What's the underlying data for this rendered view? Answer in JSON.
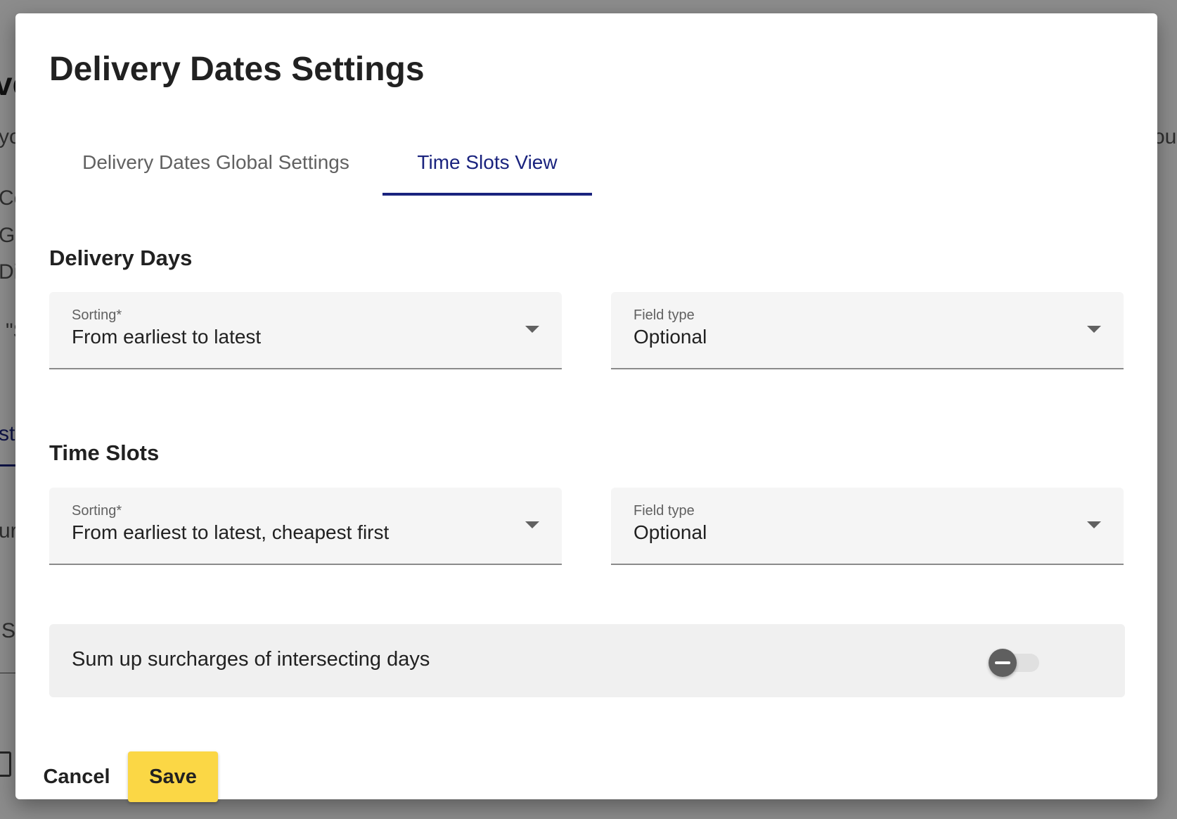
{
  "background": {
    "title_fragment": "ve",
    "text_fragments": [
      "yo",
      "Co",
      "Ge",
      "Dis",
      "\"S",
      "sto",
      "ure",
      "Se",
      "ou"
    ]
  },
  "dialog": {
    "title": "Delivery Dates Settings",
    "tabs": [
      {
        "label": "Delivery Dates Global Settings",
        "active": false
      },
      {
        "label": "Time Slots View",
        "active": true
      }
    ],
    "delivery_days": {
      "title": "Delivery Days",
      "sorting": {
        "label": "Sorting*",
        "value": "From earliest to latest"
      },
      "field_type": {
        "label": "Field type",
        "value": "Optional"
      }
    },
    "time_slots": {
      "title": "Time Slots",
      "sorting": {
        "label": "Sorting*",
        "value": "From earliest to latest, cheapest first"
      },
      "field_type": {
        "label": "Field type",
        "value": "Optional"
      }
    },
    "sum_surcharges": {
      "label": "Sum up surcharges of intersecting days",
      "state": "indeterminate"
    },
    "buttons": {
      "cancel": "Cancel",
      "save": "Save"
    }
  },
  "colors": {
    "accent": "#1a237e",
    "save_button": "#fbd745",
    "field_background": "#f5f5f5"
  }
}
